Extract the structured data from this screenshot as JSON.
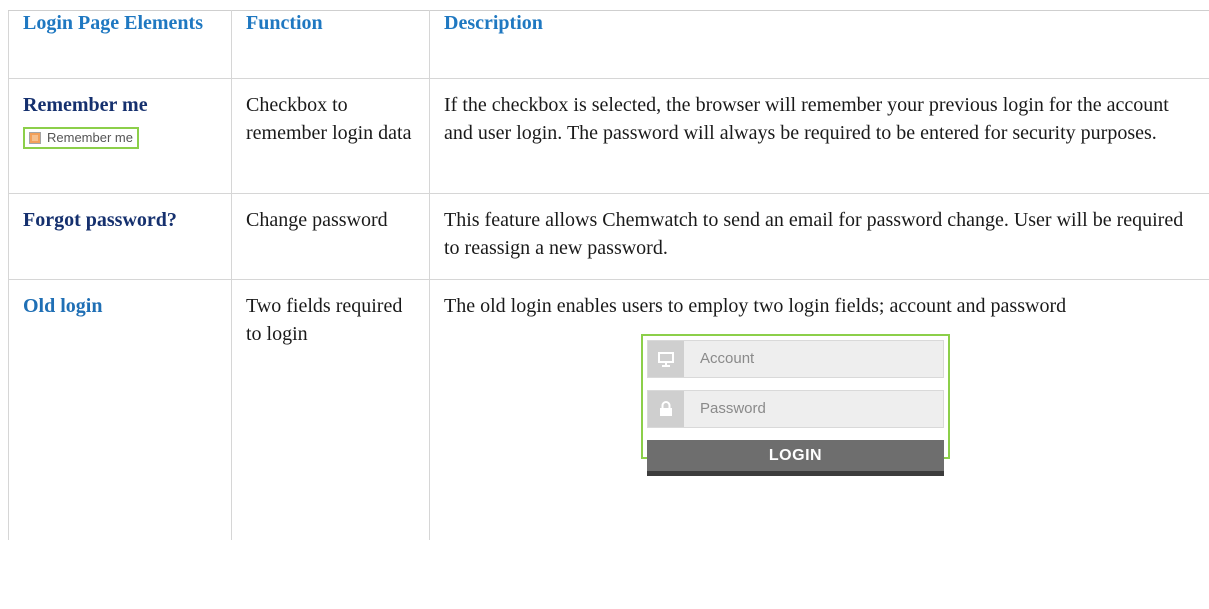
{
  "table": {
    "headers": [
      "Login Page Elements",
      "Function",
      "Description"
    ],
    "rows": [
      {
        "element": "Remember me",
        "function": "Checkbox to remember login data",
        "description": "If the checkbox is selected, the browser will remember your previous login for the account and user login. The password will always be required to be entered for security purposes.",
        "widget_label": "Remember me"
      },
      {
        "element": "Forgot password?",
        "function": "Change password",
        "description": "This feature allows Chemwatch to send an email for password change. User will be required to reassign a new password."
      },
      {
        "element": "Old login",
        "function": "Two fields required to login",
        "description": "The old login enables users to employ two login fields; account and password",
        "login_widget": {
          "account_placeholder": "Account",
          "password_placeholder": "Password",
          "button_label": "LOGIN"
        }
      }
    ]
  },
  "colors": {
    "header_blue": "#1f78c1",
    "label_navy": "#15306e",
    "widget_border_green": "#8ccf4a"
  }
}
